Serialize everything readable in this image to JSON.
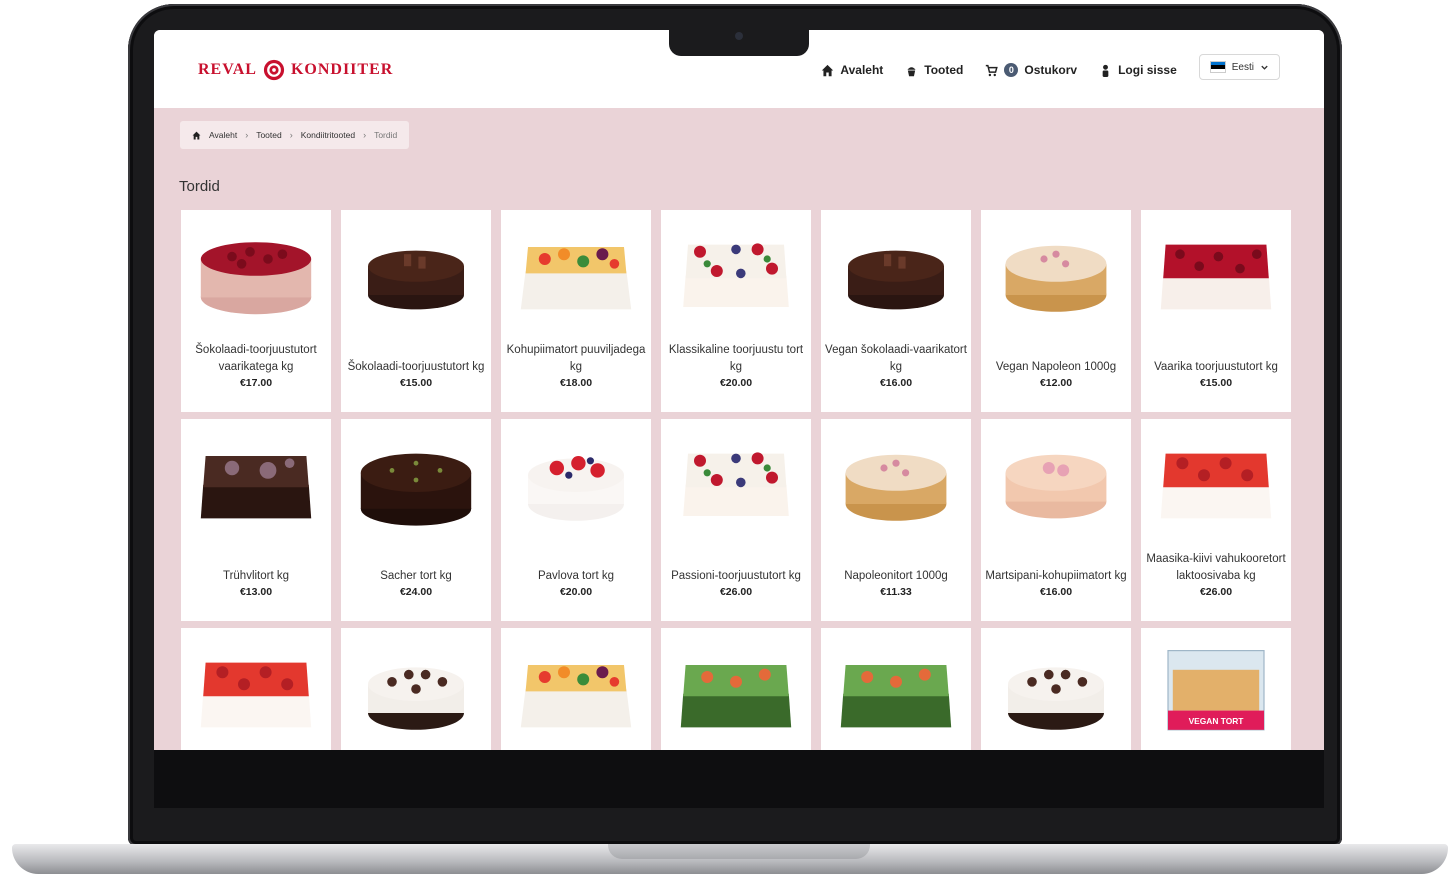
{
  "brand": {
    "left": "REVAL",
    "right": "KONDIITER",
    "color": "#c8102e"
  },
  "nav": {
    "home": "Avaleht",
    "products": "Tooted",
    "cart": "Ostukorv",
    "cart_count": "0",
    "login": "Logi sisse",
    "language": "Eesti"
  },
  "breadcrumb": [
    "Avaleht",
    "Tooted",
    "Kondiitritooted",
    "Tordid"
  ],
  "page_title": "Tordid",
  "colors": {
    "page_bg": "#ead3d7",
    "accent": "#c8102e"
  },
  "products": [
    {
      "name": "Šokolaadi-toorjuustutort vaarikatega kg",
      "price": "€17.00",
      "image": "round-cake-raspberry-top"
    },
    {
      "name": "Šokolaadi-toorjuustutort kg",
      "price": "€15.00",
      "image": "round-chocolate-cake"
    },
    {
      "name": "Kohupiimatort puuviljadega kg",
      "price": "€18.00",
      "image": "square-fruit-cake"
    },
    {
      "name": "Klassikaline toorjuustu tort kg",
      "price": "€20.00",
      "image": "square-berry-ring-cake"
    },
    {
      "name": "Vegan šokolaadi-vaarikatort kg",
      "price": "€16.00",
      "image": "round-chocolate-cake"
    },
    {
      "name": "Vegan Napoleon 1000g",
      "price": "€12.00",
      "image": "round-napoleon-cake"
    },
    {
      "name": "Vaarika toorjuustutort kg",
      "price": "€15.00",
      "image": "square-raspberry-cake"
    },
    {
      "name": "Trühvlitort kg",
      "price": "€13.00",
      "image": "square-truffle-cake"
    },
    {
      "name": "Sacher tort kg",
      "price": "€24.00",
      "image": "round-sacher-cake"
    },
    {
      "name": "Pavlova tort kg",
      "price": "€20.00",
      "image": "round-pavlova-cake"
    },
    {
      "name": "Passioni-toorjuustutort kg",
      "price": "€26.00",
      "image": "square-berry-ring-cake"
    },
    {
      "name": "Napoleonitort 1000g",
      "price": "€11.33",
      "image": "round-napoleon-cake"
    },
    {
      "name": "Martsipani-kohupiimatort kg",
      "price": "€16.00",
      "image": "round-marzipan-cake"
    },
    {
      "name": "Maasika-kiivi vahukooretort laktoosivaba kg",
      "price": "€26.00",
      "image": "square-strawberry-cake"
    },
    {
      "name": "",
      "price": "",
      "image": "square-strawberry-cake"
    },
    {
      "name": "",
      "price": "",
      "image": "round-cream-cake"
    },
    {
      "name": "",
      "price": "",
      "image": "square-fruit-cake"
    },
    {
      "name": "",
      "price": "",
      "image": "square-savory-cake"
    },
    {
      "name": "",
      "price": "",
      "image": "square-savory-cake"
    },
    {
      "name": "",
      "price": "",
      "image": "round-cream-cake"
    },
    {
      "name": "",
      "price": "",
      "image": "boxed-vegan-cake",
      "box_label": "VEGAN TORT"
    }
  ]
}
